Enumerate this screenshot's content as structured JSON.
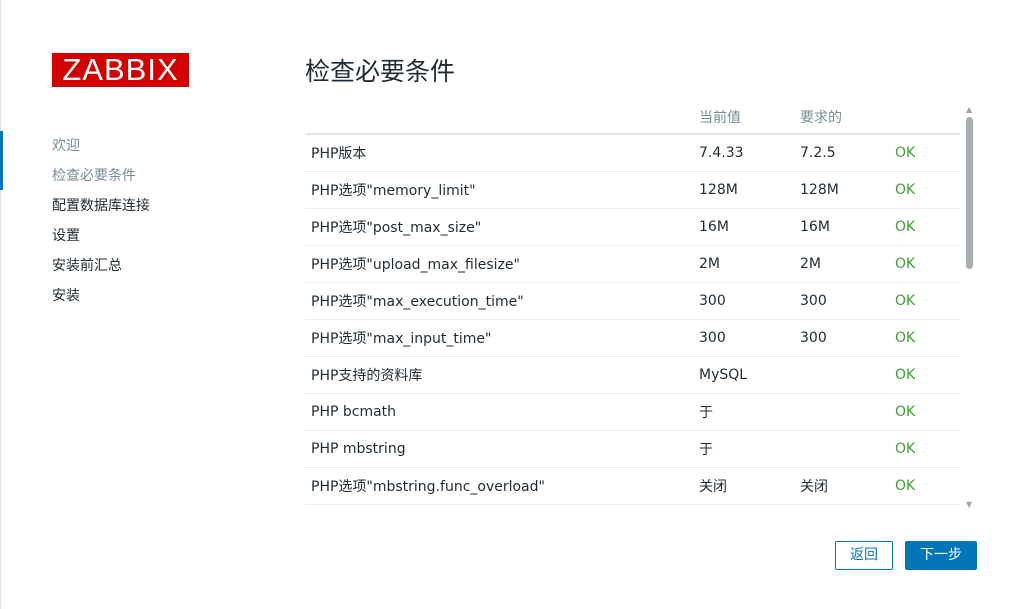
{
  "logo": "ZABBIX",
  "nav": [
    {
      "label": "欢迎"
    },
    {
      "label": "检查必要条件"
    },
    {
      "label": "配置数据库连接"
    },
    {
      "label": "设置"
    },
    {
      "label": "安装前汇总"
    },
    {
      "label": "安装"
    }
  ],
  "title": "检查必要条件",
  "table": {
    "headers": [
      "",
      "当前值",
      "要求的",
      ""
    ],
    "rows": [
      {
        "name": "PHP版本",
        "current": "7.4.33",
        "required": "7.2.5",
        "status": "OK"
      },
      {
        "name": "PHP选项\"memory_limit\"",
        "current": "128M",
        "required": "128M",
        "status": "OK"
      },
      {
        "name": "PHP选项\"post_max_size\"",
        "current": "16M",
        "required": "16M",
        "status": "OK"
      },
      {
        "name": "PHP选项\"upload_max_filesize\"",
        "current": "2M",
        "required": "2M",
        "status": "OK"
      },
      {
        "name": "PHP选项\"max_execution_time\"",
        "current": "300",
        "required": "300",
        "status": "OK"
      },
      {
        "name": "PHP选项\"max_input_time\"",
        "current": "300",
        "required": "300",
        "status": "OK"
      },
      {
        "name": "PHP支持的资料库",
        "current": "MySQL",
        "required": "",
        "status": "OK"
      },
      {
        "name": "PHP bcmath",
        "current": "于",
        "required": "",
        "status": "OK"
      },
      {
        "name": "PHP mbstring",
        "current": "于",
        "required": "",
        "status": "OK"
      },
      {
        "name": "PHP选项\"mbstring.func_overload\"",
        "current": "关闭",
        "required": "关闭",
        "status": "OK"
      }
    ]
  },
  "buttons": {
    "back": "返回",
    "next": "下一步"
  },
  "colors": {
    "accent": "#0275b8",
    "ok": "#3f9e34",
    "logo": "#d40000"
  },
  "icons": {
    "scroll_up": "triangle-up",
    "scroll_down": "triangle-down"
  }
}
